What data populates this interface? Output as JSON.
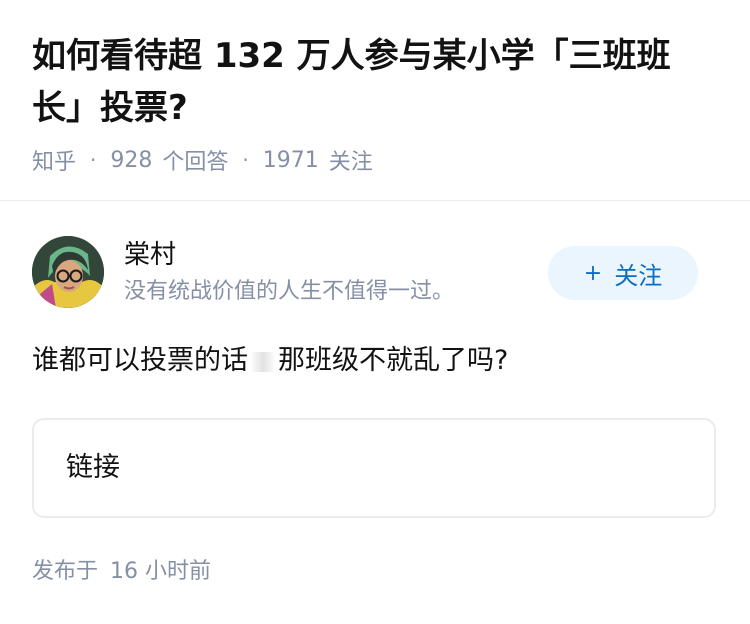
{
  "question": {
    "title": "如何看待超 132 万人参与某小学「三班班长」投票?",
    "source": "知乎",
    "answer_count": "928",
    "answer_label": "个回答",
    "follower_count": "1971",
    "follower_label": "关注",
    "separator": "·"
  },
  "author": {
    "name": "棠村",
    "bio": "没有统战价值的人生不值得一过。",
    "follow_icon": "+",
    "follow_label": "关注"
  },
  "answer": {
    "text_before": "谁都可以投票的话",
    "text_after": "那班级不就乱了吗?"
  },
  "link_card": {
    "label": "链接"
  },
  "footer": {
    "published_prefix": "发布于",
    "published_time": "16 小时前"
  },
  "colors": {
    "muted_text": "#8590a6",
    "follow_button_bg": "#ebf5fd",
    "follow_button_text": "#0b6ec0"
  }
}
